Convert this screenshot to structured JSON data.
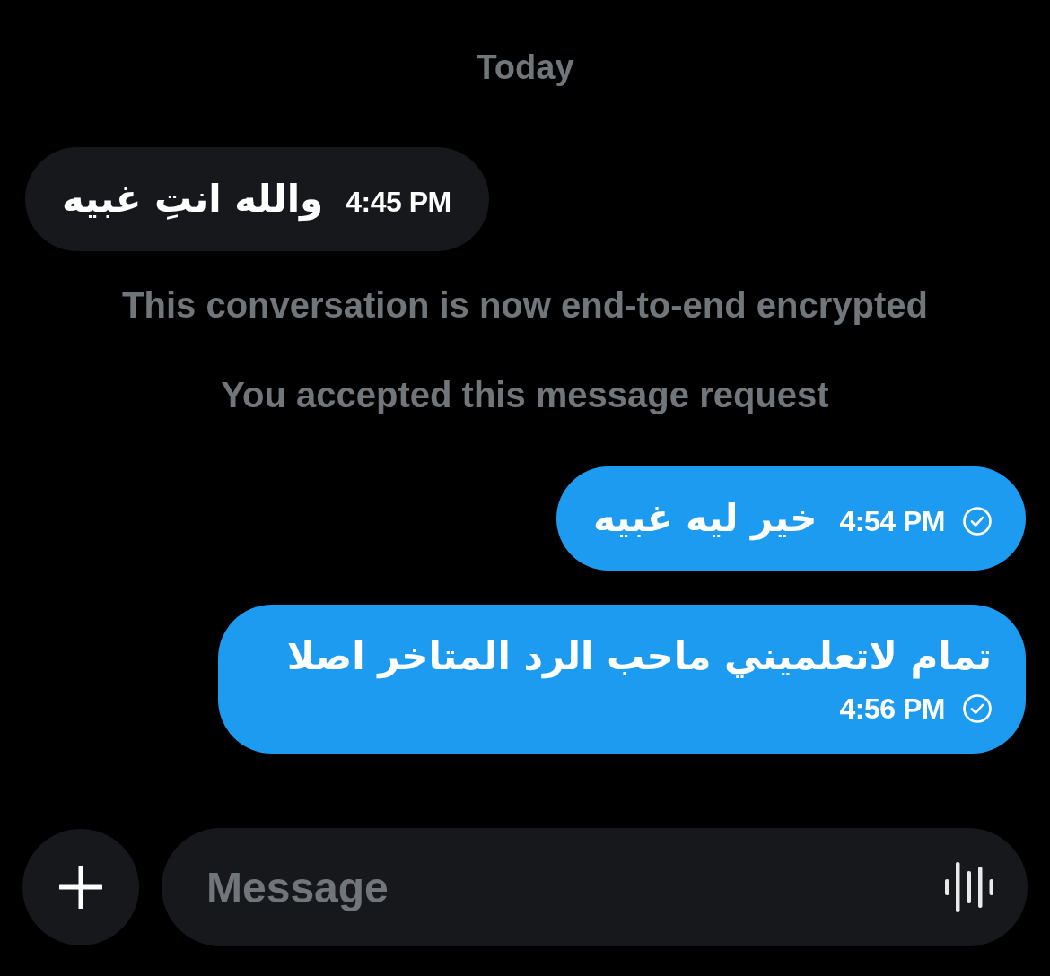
{
  "date_separator": "Today",
  "messages": [
    {
      "kind": "received",
      "text": "والله انتِ غبيه",
      "time": "4:45 PM"
    },
    {
      "kind": "notice",
      "text": "This conversation is now end-to-end encrypted"
    },
    {
      "kind": "notice",
      "text": "You accepted this message request"
    },
    {
      "kind": "sent",
      "text": "خير ليه غبيه",
      "time": "4:54 PM",
      "sent": true
    },
    {
      "kind": "sent",
      "text": "تمام لاتعلميني ماحب الرد المتاخر اصلا",
      "time": "4:56 PM",
      "sent": true
    }
  ],
  "composer": {
    "placeholder": "Message"
  }
}
